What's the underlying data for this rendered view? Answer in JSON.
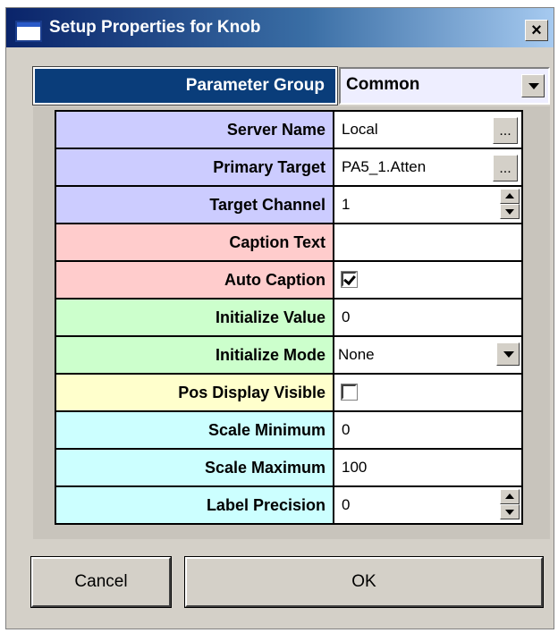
{
  "window": {
    "title": "Setup Properties for Knob",
    "close_label": "×"
  },
  "parameter_group": {
    "label": "Parameter Group",
    "value": "Common"
  },
  "rows": [
    {
      "label": "Server Name",
      "value": "Local",
      "color": "#ccccff",
      "control": "ellipsis"
    },
    {
      "label": "Primary Target",
      "value": "PA5_1.Atten",
      "color": "#ccccff",
      "control": "ellipsis"
    },
    {
      "label": "Target Channel",
      "value": "1",
      "color": "#ccccff",
      "control": "spin"
    },
    {
      "label": "Caption Text",
      "value": "",
      "color": "#ffcccc",
      "control": "text"
    },
    {
      "label": "Auto Caption",
      "checked": true,
      "color": "#ffcccc",
      "control": "check"
    },
    {
      "label": "Initialize Value",
      "value": "0",
      "color": "#ccffcc",
      "control": "text"
    },
    {
      "label": "Initialize Mode",
      "value": "None",
      "color": "#ccffcc",
      "control": "dropdown"
    },
    {
      "label": "Pos Display Visible",
      "checked": false,
      "color": "#ffffcc",
      "control": "check"
    },
    {
      "label": "Scale Minimum",
      "value": "0",
      "color": "#ccffff",
      "control": "text"
    },
    {
      "label": "Scale Maximum",
      "value": "100",
      "color": "#ccffff",
      "control": "text"
    },
    {
      "label": "Label Precision",
      "value": "0",
      "color": "#ccffff",
      "control": "spin"
    }
  ],
  "ellipsis_label": "...",
  "buttons": {
    "cancel": "Cancel",
    "ok": "OK"
  }
}
